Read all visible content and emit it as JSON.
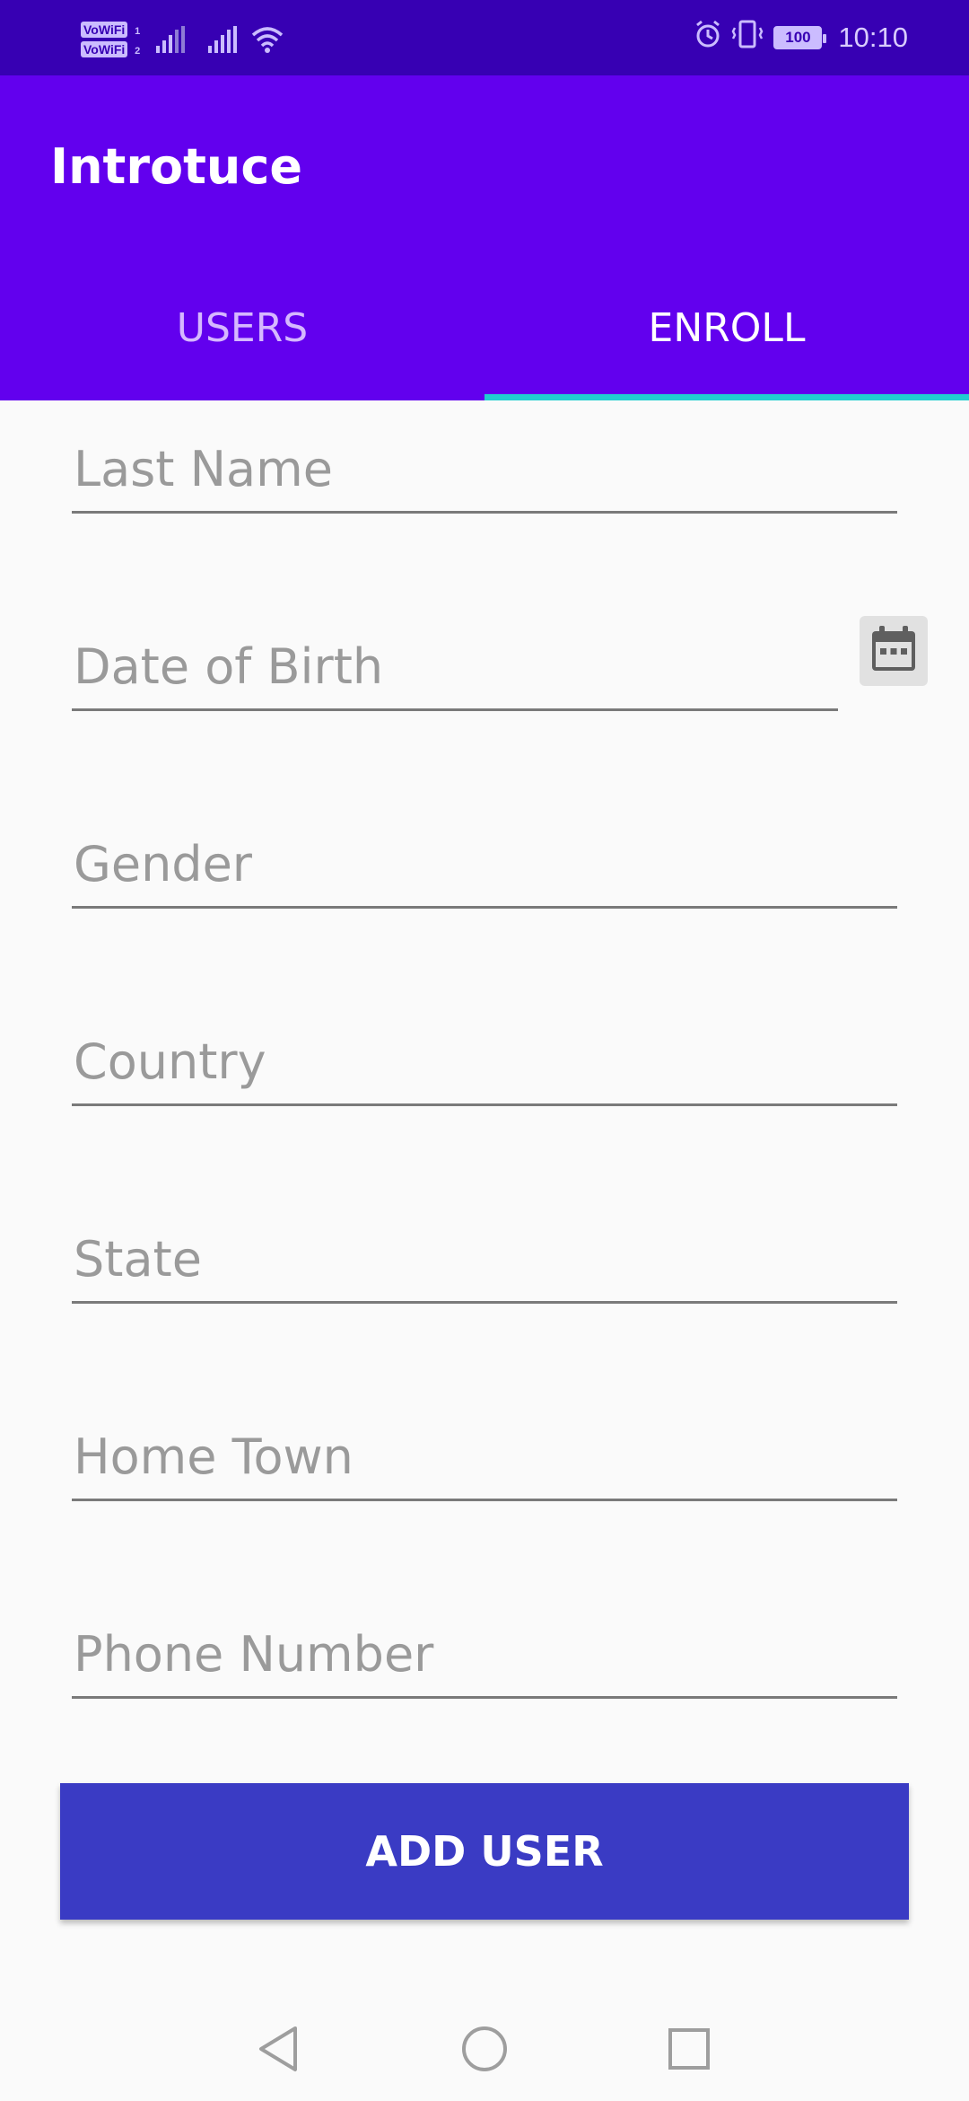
{
  "status_bar": {
    "vowifi_1": "VoWiFi",
    "vowifi_1_sub": "1",
    "vowifi_2": "VoWiFi",
    "vowifi_2_sub": "2",
    "battery": "100",
    "time": "10:10"
  },
  "app": {
    "title": "Introtuce",
    "tabs": [
      {
        "label": "USERS",
        "active": false
      },
      {
        "label": "ENROLL",
        "active": true
      }
    ],
    "accent_color": "#6200ee",
    "indicator_color": "#20cfd0"
  },
  "form": {
    "fields": [
      {
        "placeholder": "Last Name"
      },
      {
        "placeholder": "Date of Birth"
      },
      {
        "placeholder": "Gender"
      },
      {
        "placeholder": "Country"
      },
      {
        "placeholder": "State"
      },
      {
        "placeholder": "Home Town"
      },
      {
        "placeholder": "Phone Number"
      }
    ],
    "submit_label": "ADD USER",
    "calendar_icon": "calendar-icon"
  },
  "nav": {
    "back_icon": "back-triangle-icon",
    "home_icon": "home-circle-icon",
    "recents_icon": "recents-square-icon"
  }
}
